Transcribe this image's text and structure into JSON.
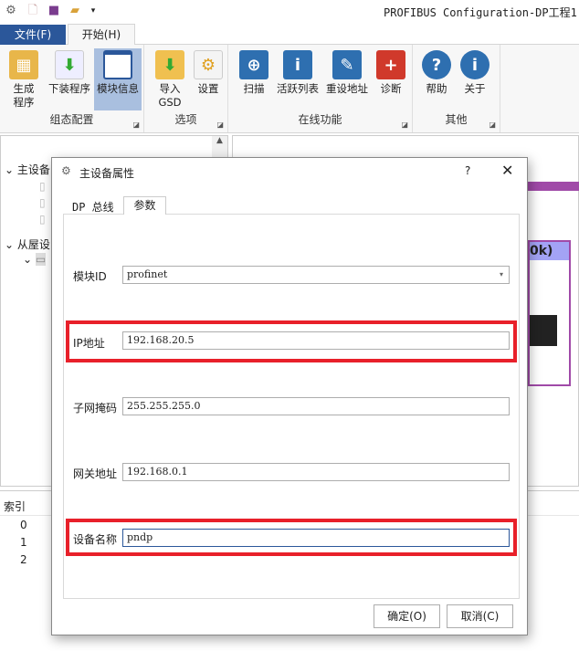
{
  "window": {
    "title": "PROFIBUS Configuration-DP工程1"
  },
  "quick_access": {
    "icons": [
      "app-gear-icon",
      "new-file-icon",
      "save-icon",
      "open-folder-icon",
      "customize-dropdown-icon"
    ]
  },
  "ribbon": {
    "tabs": [
      {
        "label": "文件(F)"
      },
      {
        "label": "开始(H)"
      }
    ],
    "groups": [
      {
        "label": "组态配置",
        "buttons": [
          {
            "label": "生成\n程序",
            "l1": "生成",
            "l2": "程序"
          },
          {
            "label": "下装程序"
          },
          {
            "label": "模块信息"
          }
        ]
      },
      {
        "label": "选项",
        "buttons": [
          {
            "l1": "导入",
            "l2": "GSD"
          },
          {
            "label": "设置"
          }
        ]
      },
      {
        "label": "在线功能",
        "buttons": [
          {
            "label": "扫描"
          },
          {
            "label": "活跃列表"
          },
          {
            "label": "重设地址"
          },
          {
            "label": "诊断"
          }
        ]
      },
      {
        "label": "其他",
        "buttons": [
          {
            "label": "帮助"
          },
          {
            "label": "关于"
          }
        ]
      }
    ]
  },
  "tree": {
    "items": [
      {
        "label": "主设备"
      },
      {
        "label": "从屋设"
      }
    ]
  },
  "device_view": {
    "header": "0k)"
  },
  "bottom_panel": {
    "column": "索引",
    "rows": [
      "0",
      "1",
      "2"
    ]
  },
  "dialog": {
    "title": "主设备属性",
    "help": "?",
    "tabs": [
      {
        "label": "DP 总线"
      },
      {
        "label": "参数"
      }
    ],
    "fields": {
      "module_id": {
        "label": "模块ID",
        "value": "profinet"
      },
      "ip": {
        "label": "IP地址",
        "value": "192.168.20.5"
      },
      "subnet": {
        "label": "子网掩码",
        "value": "255.255.255.0"
      },
      "gateway": {
        "label": "网关地址",
        "value": "192.168.0.1"
      },
      "device_name": {
        "label": "设备名称",
        "value": "pndp"
      }
    },
    "ok": "确定(O)",
    "cancel": "取消(C)"
  },
  "colors": {
    "file_tab": "#2b579a",
    "highlight": "#e8202a",
    "selected_button": "#a9bfdf",
    "purple": "#a04aa8"
  }
}
